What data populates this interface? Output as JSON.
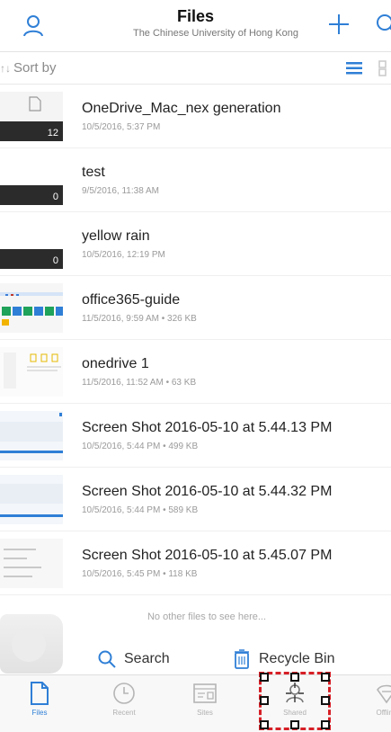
{
  "header": {
    "title": "Files",
    "subtitle": "The Chinese University of Hong Kong"
  },
  "sortbar": {
    "label": "Sort by",
    "arrows": "↑↓"
  },
  "files": [
    {
      "name": "OneDrive_Mac_nex generation",
      "meta": "10/5/2016, 5:37 PM",
      "kind": "folder",
      "count": "12"
    },
    {
      "name": "test",
      "meta": "9/5/2016, 11:38 AM",
      "kind": "folder",
      "count": "0"
    },
    {
      "name": "yellow rain",
      "meta": "10/5/2016, 12:19 PM",
      "kind": "folder",
      "count": "0"
    },
    {
      "name": "office365-guide",
      "meta": "11/5/2016, 9:59 AM • 326 KB",
      "kind": "image"
    },
    {
      "name": "onedrive 1",
      "meta": "11/5/2016, 11:52 AM • 63 KB",
      "kind": "image"
    },
    {
      "name": "Screen Shot 2016-05-10 at 5.44.13 PM",
      "meta": "10/5/2016, 5:44 PM • 499 KB",
      "kind": "image"
    },
    {
      "name": "Screen Shot 2016-05-10 at 5.44.32 PM",
      "meta": "10/5/2016, 5:44 PM • 589 KB",
      "kind": "image"
    },
    {
      "name": "Screen Shot 2016-05-10 at 5.45.07 PM",
      "meta": "10/5/2016, 5:45 PM • 118 KB",
      "kind": "image"
    }
  ],
  "empty_note": "No other files to see here...",
  "actions": {
    "search": "Search",
    "recycle": "Recycle Bin"
  },
  "tabs": [
    {
      "label": "Files",
      "icon": "file-icon",
      "active": true
    },
    {
      "label": "Recent",
      "icon": "clock-icon"
    },
    {
      "label": "Sites",
      "icon": "sites-icon"
    },
    {
      "label": "Shared",
      "icon": "shared-icon"
    },
    {
      "label": "Offline",
      "icon": "offline-icon"
    }
  ],
  "colors": {
    "accent": "#2f7fd6",
    "highlight": "#d61f26",
    "folder": "#2b2b2b"
  }
}
